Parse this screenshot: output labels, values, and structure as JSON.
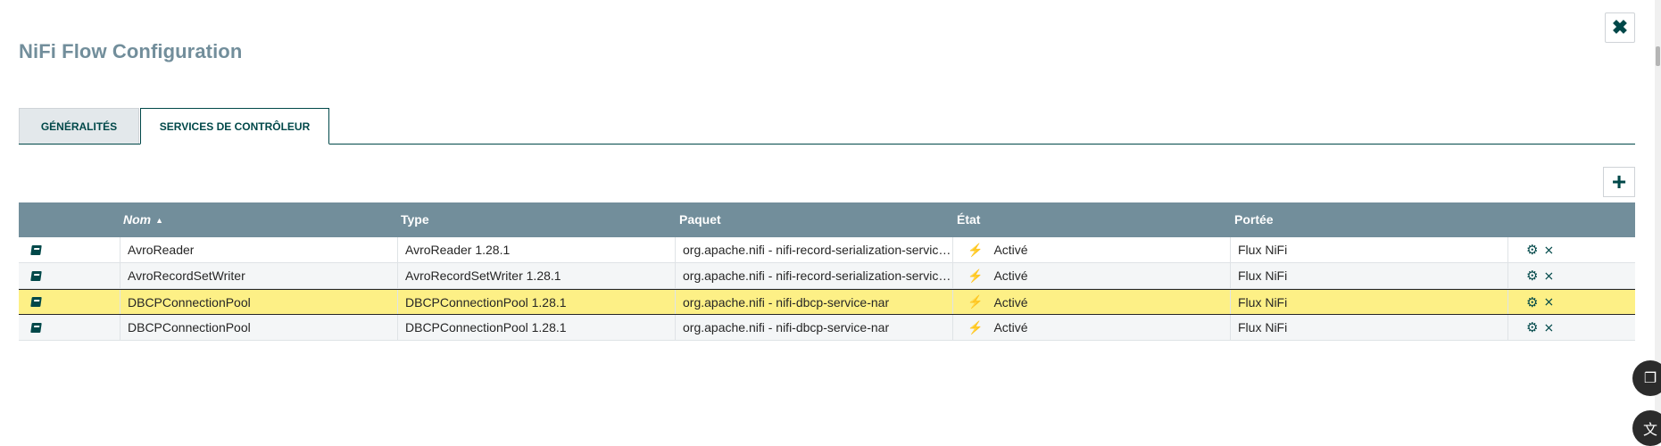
{
  "dialog": {
    "title": "NiFi Flow Configuration",
    "close_label": "✖"
  },
  "tabs": [
    {
      "label": "GÉNÉRALITÉS",
      "active": false
    },
    {
      "label": "SERVICES DE CONTRÔLEUR",
      "active": true
    }
  ],
  "add_button_label": "+",
  "table": {
    "headers": {
      "name": "Nom",
      "type": "Type",
      "bundle": "Paquet",
      "state": "État",
      "scope": "Portée"
    },
    "sort_indicator": "▲",
    "rows": [
      {
        "name": "AvroReader",
        "type": "AvroReader 1.28.1",
        "bundle": "org.apache.nifi - nifi-record-serialization-services-nar",
        "state": "Activé",
        "scope": "Flux NiFi",
        "selected": false
      },
      {
        "name": "AvroRecordSetWriter",
        "type": "AvroRecordSetWriter 1.28.1",
        "bundle": "org.apache.nifi - nifi-record-serialization-services-nar",
        "state": "Activé",
        "scope": "Flux NiFi",
        "selected": false
      },
      {
        "name": "DBCPConnectionPool",
        "type": "DBCPConnectionPool 1.28.1",
        "bundle": "org.apache.nifi - nifi-dbcp-service-nar",
        "state": "Activé",
        "scope": "Flux NiFi",
        "selected": true
      },
      {
        "name": "DBCPConnectionPool",
        "type": "DBCPConnectionPool 1.28.1",
        "bundle": "org.apache.nifi - nifi-dbcp-service-nar",
        "state": "Activé",
        "scope": "Flux NiFi",
        "selected": false
      }
    ]
  },
  "icons": {
    "usage": "book-icon",
    "state": "bolt-icon",
    "configure": "gear-icon",
    "disable": "disable-icon"
  },
  "colors": {
    "header_bg": "#728e9b",
    "accent": "#004849",
    "selected_row": "#fdf086",
    "enabled_bolt": "#3b8ed3"
  }
}
